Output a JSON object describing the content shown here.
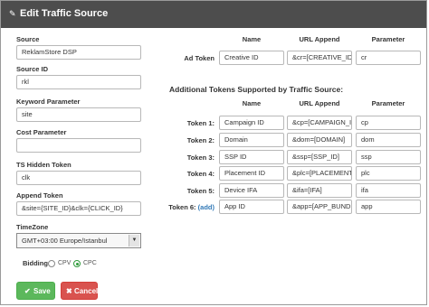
{
  "header": {
    "title": "Edit Traffic Source",
    "icon": "edit-icon"
  },
  "left": {
    "source_label": "Source",
    "source_value": "ReklamStore DSP",
    "source_id_label": "Source ID",
    "source_id_value": "rkl",
    "keyword_label": "Keyword Parameter",
    "keyword_value": "site",
    "cost_label": "Cost Parameter",
    "cost_value": "",
    "ts_hidden_label": "TS Hidden Token",
    "ts_hidden_value": "clk",
    "append_label": "Append Token",
    "append_value": "&site={SITE_ID}&clk={CLICK_ID}",
    "timezone_label": "TimeZone",
    "timezone_value": "GMT+03:00 Europe/Istanbul",
    "bidding_label": "Bidding",
    "bidding_options": [
      "CPV",
      "CPC"
    ],
    "bidding_selected": "CPC"
  },
  "buttons": {
    "save": "Save",
    "cancel": "Cancel"
  },
  "columns": {
    "name": "Name",
    "url_append": "URL Append",
    "parameter": "Parameter"
  },
  "ad_token": {
    "label": "Ad Token",
    "name": "Creative ID",
    "url": "&cr=[CREATIVE_ID]",
    "param": "cr"
  },
  "additional_title": "Additional Tokens Supported by Traffic Source:",
  "tokens": [
    {
      "label": "Token 1:",
      "name": "Campaign ID",
      "url": "&cp=[CAMPAIGN_ID]",
      "param": "cp"
    },
    {
      "label": "Token 2:",
      "name": "Domain",
      "url": "&dom=[DOMAIN]",
      "param": "dom"
    },
    {
      "label": "Token 3:",
      "name": "SSP ID",
      "url": "&ssp=[SSP_ID]",
      "param": "ssp"
    },
    {
      "label": "Token 4:",
      "name": "Placement ID",
      "url": "&plc=[PLACEMENT_IC",
      "param": "plc"
    },
    {
      "label": "Token 5:",
      "name": "Device IFA",
      "url": "&ifa=[IFA]",
      "param": "ifa"
    },
    {
      "label": "Token 6:",
      "add": "(add)",
      "name": "App ID",
      "url": "&app=[APP_BUNDLE]",
      "param": "app"
    }
  ],
  "colors": {
    "header_bg": "#4d4d4d",
    "save": "#5cb85c",
    "cancel": "#d9534f",
    "link": "#337ab7"
  }
}
